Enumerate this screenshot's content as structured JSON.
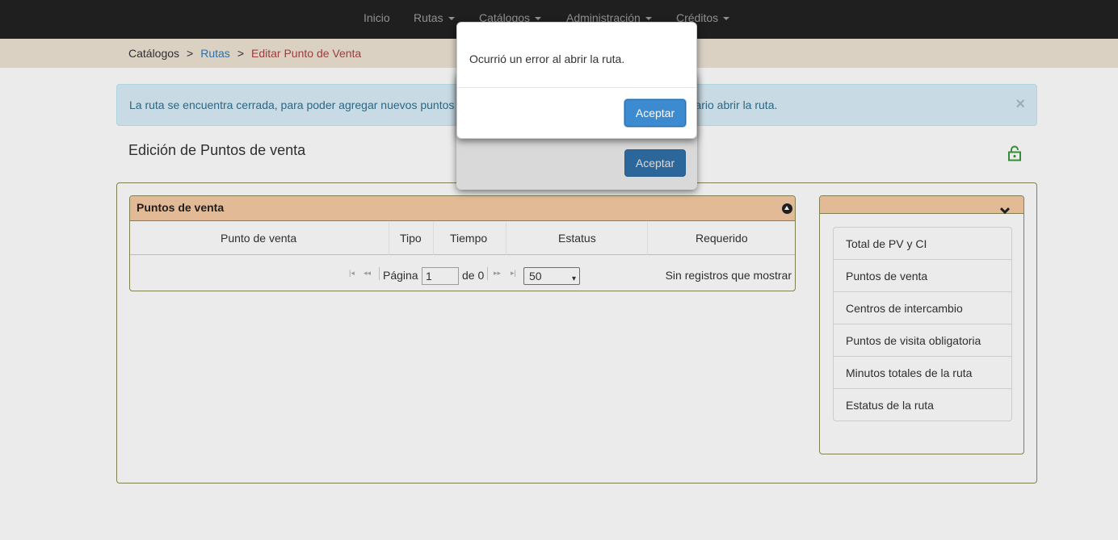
{
  "navbar": {
    "items": [
      {
        "label": "Inicio",
        "dropdown": false
      },
      {
        "label": "Rutas",
        "dropdown": true
      },
      {
        "label": "Catálogos",
        "dropdown": true
      },
      {
        "label": "Administración",
        "dropdown": true
      },
      {
        "label": "Créditos",
        "dropdown": true
      }
    ]
  },
  "breadcrumb": {
    "items": [
      "Catálogos",
      "Rutas",
      "Editar Punto de Venta"
    ],
    "separator": ">"
  },
  "alert": {
    "text": "La ruta se encuentra cerrada, para poder agregar nuevos puntos de venta o cambiar el orden de estos, es necesario abrir la ruta.",
    "close": "×"
  },
  "page": {
    "title": "Edición de Puntos de venta"
  },
  "grid": {
    "caption": "Puntos de venta",
    "columns": [
      "Punto de venta",
      "Tipo",
      "Tiempo",
      "Estatus",
      "Requerido"
    ],
    "pager": {
      "page_label": "Página",
      "page_value": "1",
      "of_label": "de 0",
      "rows_per_page": "50",
      "records_text": "Sin registros que mostrar"
    }
  },
  "side_panel": {
    "items": [
      "Total de PV y CI",
      "Puntos de venta",
      "Centros de intercambio",
      "Puntos de visita obligatoria",
      "Minutos totales de la ruta",
      "Estatus de la ruta"
    ]
  },
  "modal_back": {
    "button_label": "Aceptar"
  },
  "modal": {
    "message": "Ocurrió un error al abrir la ruta.",
    "button_label": "Aceptar"
  },
  "colors": {
    "navbar": "#222222",
    "breadcrumb_bg": "#ede3d4",
    "alert_bg": "#d9edf7",
    "grid_header": "#f7caa3",
    "primary": "#337ab7",
    "lock_icon": "#3c9a3c"
  }
}
